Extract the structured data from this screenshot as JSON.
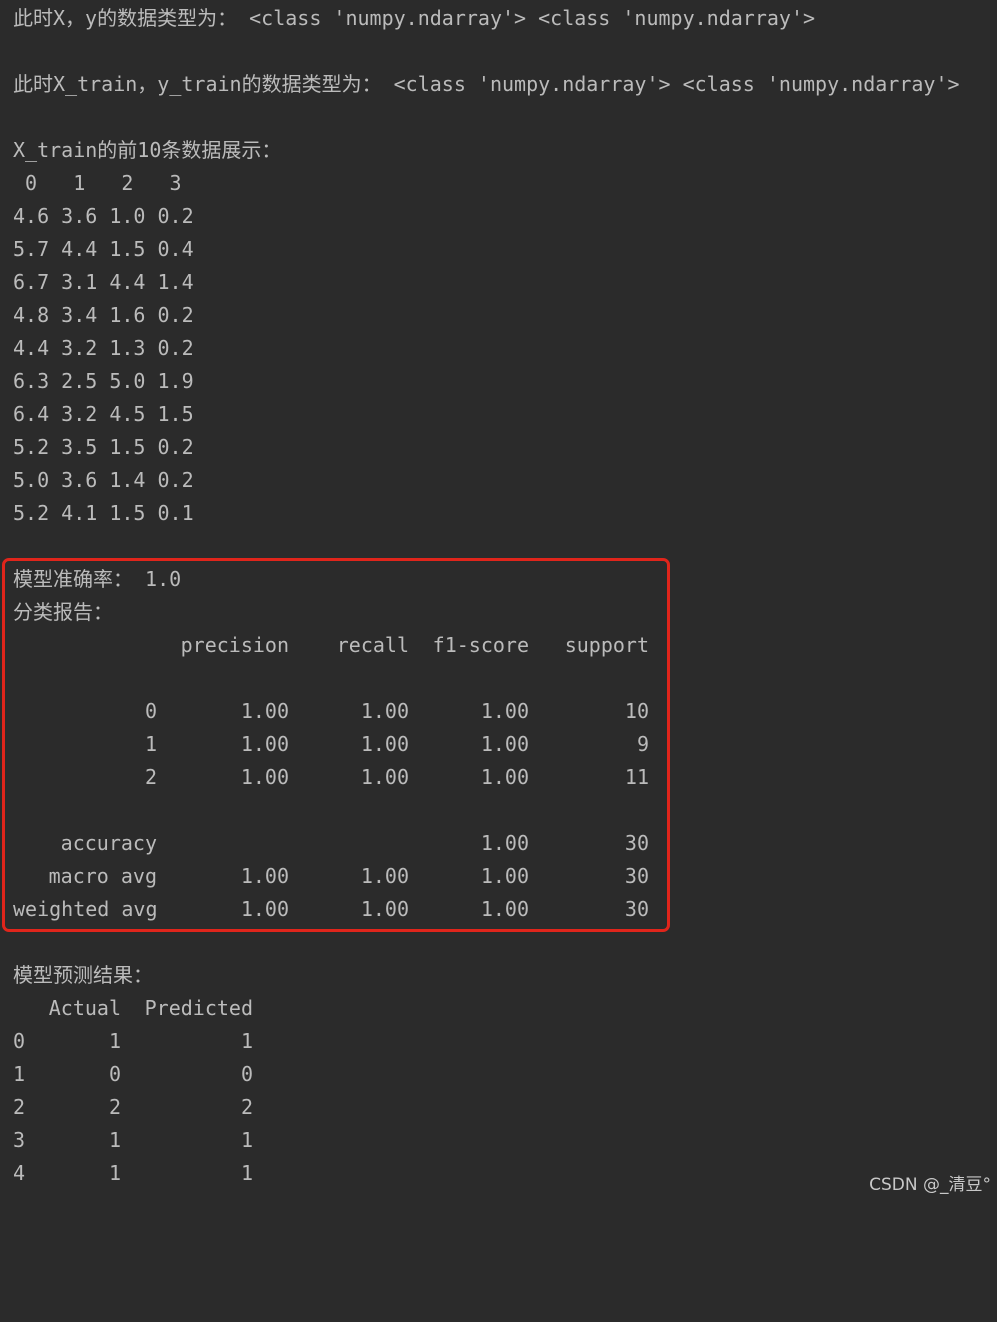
{
  "intro": {
    "xy_type_line": "此时X，y的数据类型为： <class 'numpy.ndarray'> <class 'numpy.ndarray'>",
    "train_type_line": "此时X_train，y_train的数据类型为： <class 'numpy.ndarray'> <class 'numpy.ndarray'>",
    "preview_title": "X_train的前10条数据展示：",
    "preview_header": " 0   1   2   3",
    "preview_rows": [
      "4.6 3.6 1.0 0.2",
      "5.7 4.4 1.5 0.4",
      "6.7 3.1 4.4 1.4",
      "4.8 3.4 1.6 0.2",
      "4.4 3.2 1.3 0.2",
      "6.3 2.5 5.0 1.9",
      "6.4 3.2 4.5 1.5",
      "5.2 3.5 1.5 0.2",
      "5.0 3.6 1.4 0.2",
      "5.2 4.1 1.5 0.1"
    ]
  },
  "report": {
    "accuracy_line": "模型准确率： 1.0",
    "report_title": "分类报告：",
    "columns": [
      "precision",
      "recall",
      "f1-score",
      "support"
    ],
    "rows": [
      {
        "label": "0",
        "precision": "1.00",
        "recall": "1.00",
        "f1": "1.00",
        "support": "10"
      },
      {
        "label": "1",
        "precision": "1.00",
        "recall": "1.00",
        "f1": "1.00",
        "support": "9"
      },
      {
        "label": "2",
        "precision": "1.00",
        "recall": "1.00",
        "f1": "1.00",
        "support": "11"
      }
    ],
    "summary": [
      {
        "label": "accuracy",
        "precision": "",
        "recall": "",
        "f1": "1.00",
        "support": "30"
      },
      {
        "label": "macro avg",
        "precision": "1.00",
        "recall": "1.00",
        "f1": "1.00",
        "support": "30"
      },
      {
        "label": "weighted avg",
        "precision": "1.00",
        "recall": "1.00",
        "f1": "1.00",
        "support": "30"
      }
    ]
  },
  "predictions": {
    "title": "模型预测结果：",
    "columns": [
      "Actual",
      "Predicted"
    ],
    "rows": [
      {
        "index": "0",
        "actual": "1",
        "predicted": "1"
      },
      {
        "index": "1",
        "actual": "0",
        "predicted": "0"
      },
      {
        "index": "2",
        "actual": "2",
        "predicted": "2"
      },
      {
        "index": "3",
        "actual": "1",
        "predicted": "1"
      },
      {
        "index": "4",
        "actual": "1",
        "predicted": "1"
      }
    ]
  },
  "watermark": "CSDN @_清豆°",
  "colors": {
    "background": "#2b2b2b",
    "text": "#bbbbbb",
    "highlight_border": "#e0251b"
  }
}
